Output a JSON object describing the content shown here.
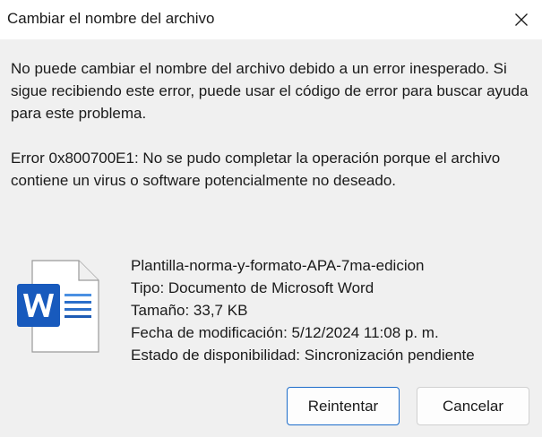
{
  "window": {
    "title": "Cambiar el nombre del archivo"
  },
  "message": {
    "line1": "No puede cambiar el nombre del archivo debido a un error inesperado. Si sigue recibiendo este error, puede usar el código de error para buscar ayuda para este problema.",
    "line2": "Error 0x800700E1: No se pudo completar la operación porque el archivo contiene un virus o software potencialmente no deseado."
  },
  "file": {
    "icon": "word-document-icon",
    "name": "Plantilla-norma-y-formato-APA-7ma-edicion",
    "type": "Tipo: Documento de Microsoft Word",
    "size": "Tamaño: 33,7 KB",
    "modified": "Fecha de modificación: 5/12/2024 11:08 p. m.",
    "availability": "Estado de disponibilidad: Sincronización pendiente"
  },
  "buttons": {
    "retry": "Reintentar",
    "cancel": "Cancelar"
  },
  "colors": {
    "word_blue": "#185abd",
    "accent_border": "#1c6cc9"
  }
}
